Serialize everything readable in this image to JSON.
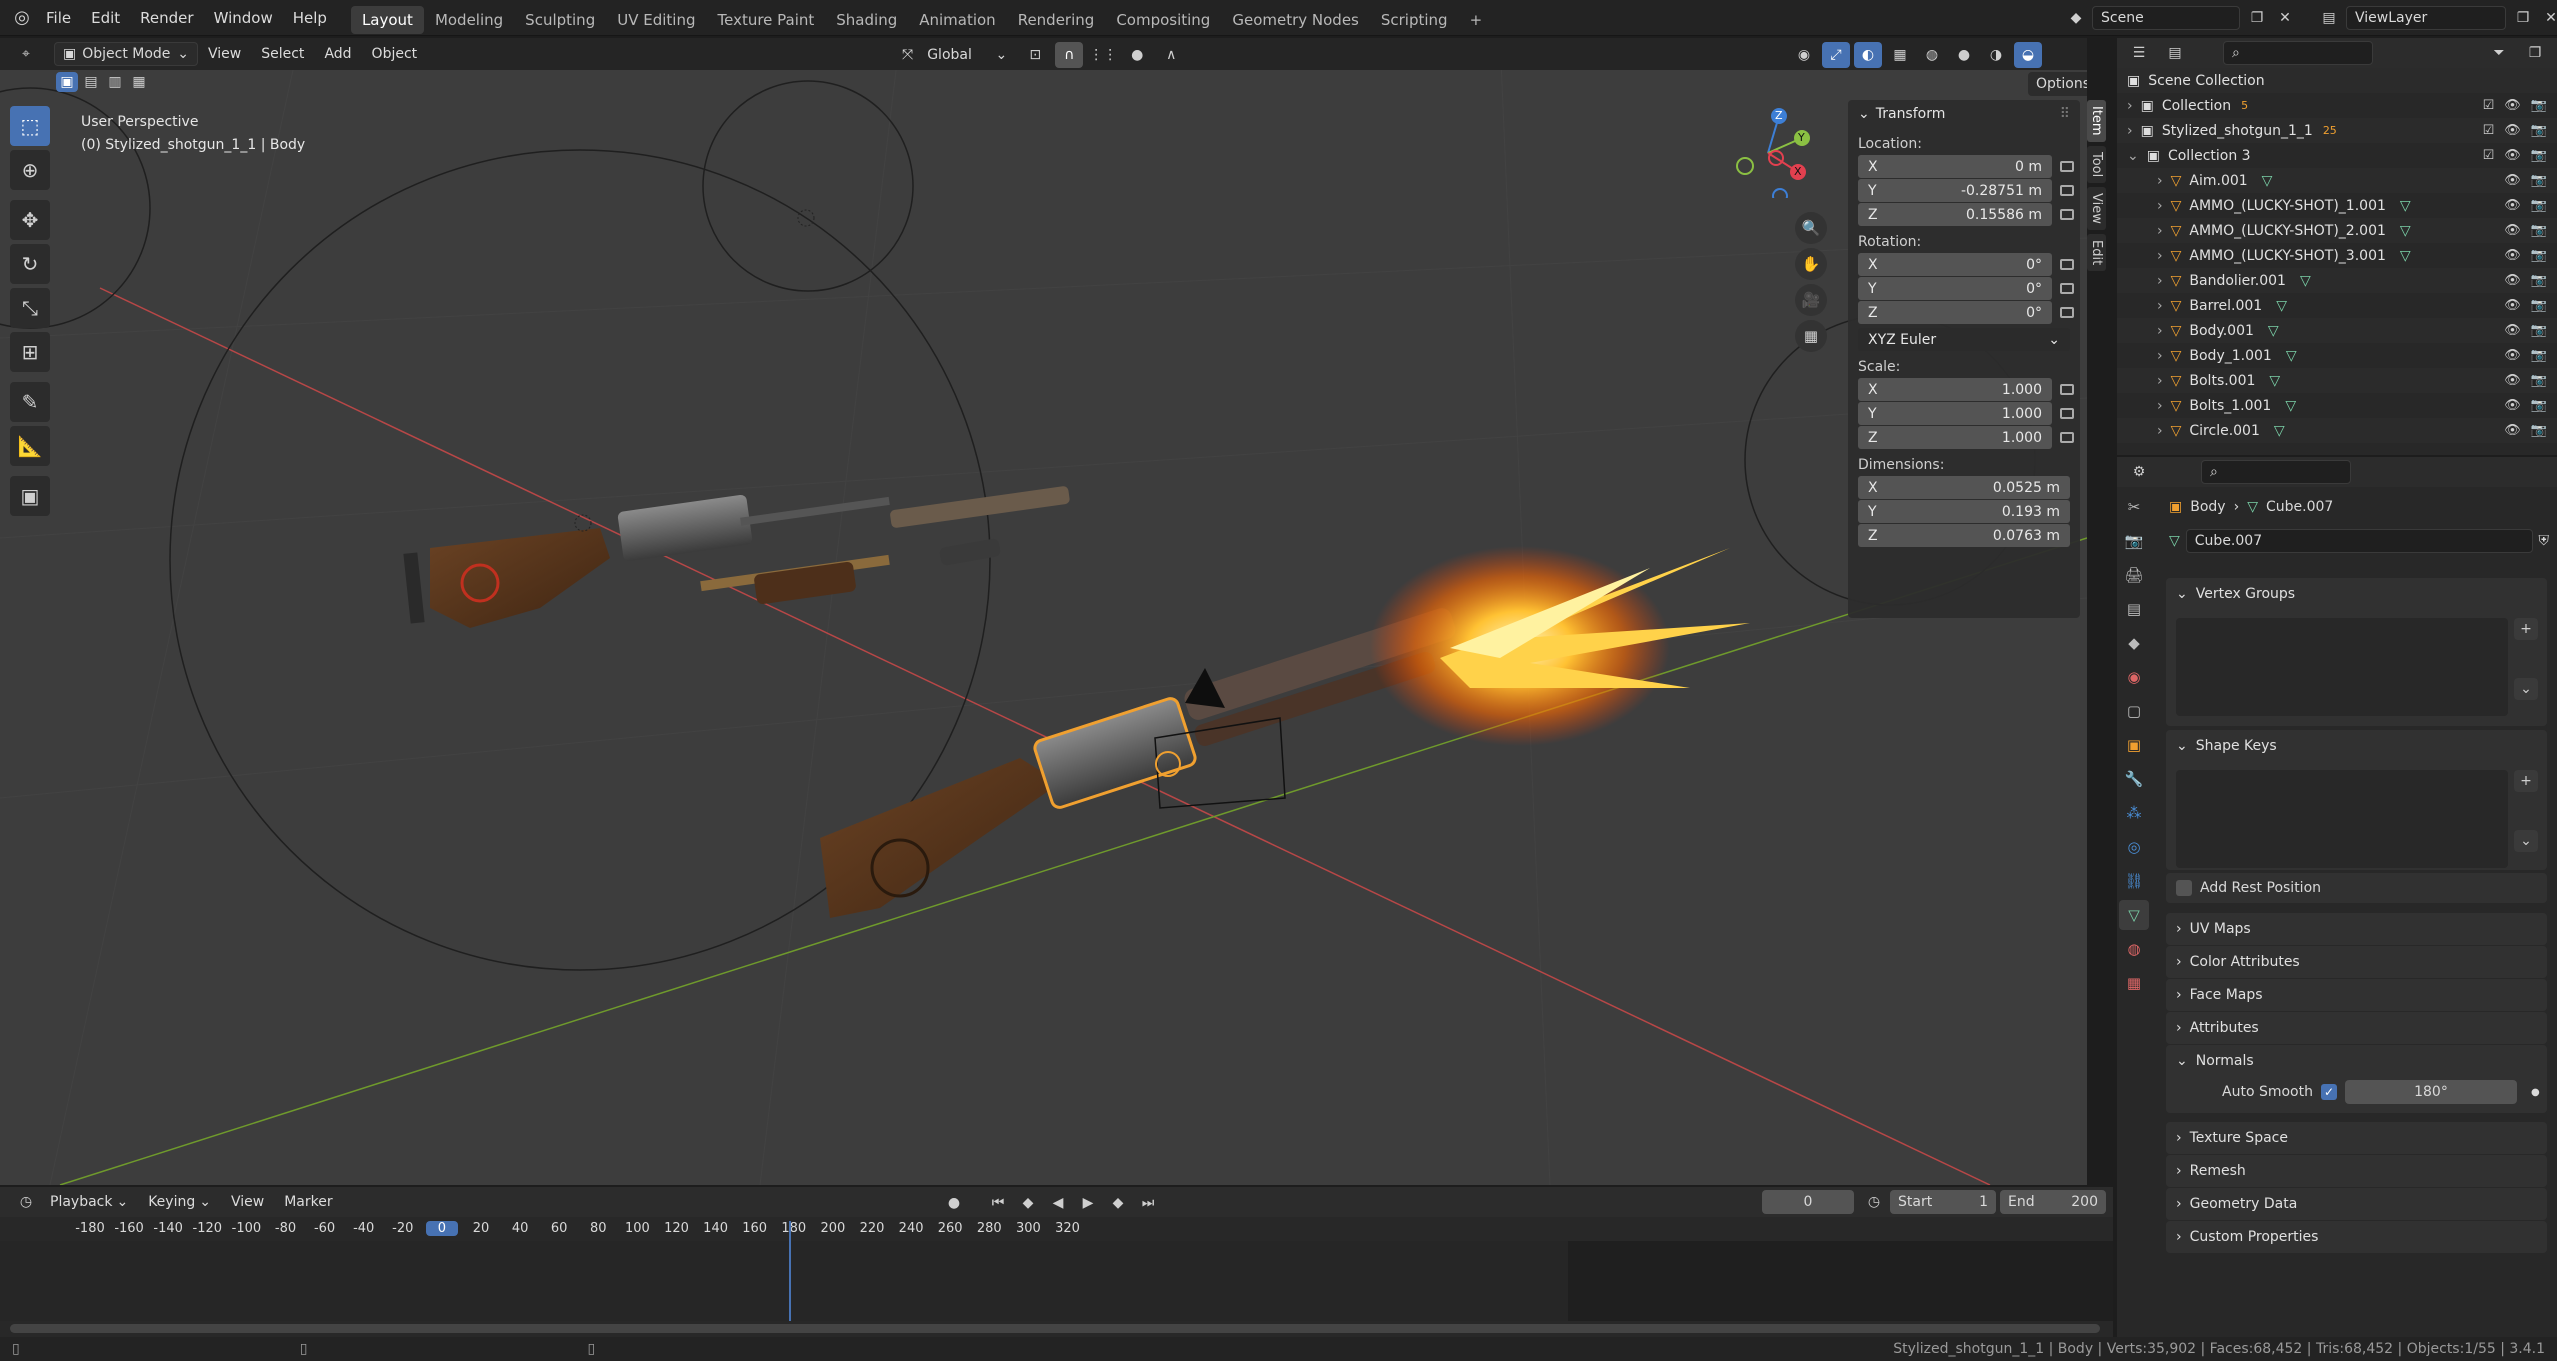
{
  "menu": {
    "items": [
      "File",
      "Edit",
      "Render",
      "Window",
      "Help"
    ]
  },
  "workspaces": [
    "Layout",
    "Modeling",
    "Sculpting",
    "UV Editing",
    "Texture Paint",
    "Shading",
    "Animation",
    "Rendering",
    "Compositing",
    "Geometry Nodes",
    "Scripting"
  ],
  "active_workspace": "Layout",
  "scene": {
    "name": "Scene",
    "view_layer": "ViewLayer"
  },
  "viewport_header": {
    "mode": "Object Mode",
    "menus": [
      "View",
      "Select",
      "Add",
      "Object"
    ],
    "orientation": "Global",
    "options_label": "Options"
  },
  "overlay_text": {
    "perspective": "User Perspective",
    "object": "(0) Stylized_shotgun_1_1 | Body"
  },
  "gizmo": {
    "x": "X",
    "y": "Y",
    "z": "Z",
    "colors": {
      "x": "#e2404f",
      "y": "#8bc043",
      "z": "#3d7fd6"
    }
  },
  "npanel": {
    "title": "Transform",
    "location_label": "Location:",
    "location": [
      {
        "axis": "X",
        "value": "0 m"
      },
      {
        "axis": "Y",
        "value": "-0.28751 m"
      },
      {
        "axis": "Z",
        "value": "0.15586 m"
      }
    ],
    "rotation_label": "Rotation:",
    "rotation": [
      {
        "axis": "X",
        "value": "0°"
      },
      {
        "axis": "Y",
        "value": "0°"
      },
      {
        "axis": "Z",
        "value": "0°"
      }
    ],
    "rotation_mode": "XYZ Euler",
    "scale_label": "Scale:",
    "scale": [
      {
        "axis": "X",
        "value": "1.000"
      },
      {
        "axis": "Y",
        "value": "1.000"
      },
      {
        "axis": "Z",
        "value": "1.000"
      }
    ],
    "dimensions_label": "Dimensions:",
    "dimensions": [
      {
        "axis": "X",
        "value": "0.0525 m"
      },
      {
        "axis": "Y",
        "value": "0.193 m"
      },
      {
        "axis": "Z",
        "value": "0.0763 m"
      }
    ],
    "tabs": [
      "Item",
      "Tool",
      "View",
      "Edit"
    ]
  },
  "outliner": {
    "root": "Scene Collection",
    "rows": [
      {
        "name": "Collection",
        "type": "collection",
        "indent": 1,
        "badge": "5"
      },
      {
        "name": "Stylized_shotgun_1_1",
        "type": "collection",
        "indent": 1,
        "badge": "25"
      },
      {
        "name": "Collection 3",
        "type": "collection",
        "indent": 1,
        "badge": ""
      },
      {
        "name": "Aim.001",
        "type": "mesh",
        "indent": 2,
        "badge": ""
      },
      {
        "name": "AMMO_(LUCKY-SHOT)_1.001",
        "type": "mesh",
        "indent": 2,
        "badge": ""
      },
      {
        "name": "AMMO_(LUCKY-SHOT)_2.001",
        "type": "mesh",
        "indent": 2,
        "badge": ""
      },
      {
        "name": "AMMO_(LUCKY-SHOT)_3.001",
        "type": "mesh",
        "indent": 2,
        "badge": ""
      },
      {
        "name": "Bandolier.001",
        "type": "mesh",
        "indent": 2,
        "badge": ""
      },
      {
        "name": "Barrel.001",
        "type": "mesh",
        "indent": 2,
        "badge": ""
      },
      {
        "name": "Body.001",
        "type": "mesh",
        "indent": 2,
        "badge": ""
      },
      {
        "name": "Body_1.001",
        "type": "mesh",
        "indent": 2,
        "badge": ""
      },
      {
        "name": "Bolts.001",
        "type": "mesh",
        "indent": 2,
        "badge": ""
      },
      {
        "name": "Bolts_1.001",
        "type": "mesh",
        "indent": 2,
        "badge": ""
      },
      {
        "name": "Circle.001",
        "type": "mesh",
        "indent": 2,
        "badge": ""
      }
    ]
  },
  "properties": {
    "breadcrumb": {
      "object": "Body",
      "mesh": "Cube.007"
    },
    "datablock": "Cube.007",
    "panels": {
      "vertex_groups": "Vertex Groups",
      "shape_keys": "Shape Keys",
      "add_rest_position": "Add Rest Position",
      "uv_maps": "UV Maps",
      "color_attributes": "Color Attributes",
      "face_maps": "Face Maps",
      "attributes": "Attributes",
      "normals": "Normals",
      "auto_smooth_label": "Auto Smooth",
      "auto_smooth_angle": "180°",
      "texture_space": "Texture Space",
      "remesh": "Remesh",
      "geometry_data": "Geometry Data",
      "custom_properties": "Custom Properties"
    }
  },
  "timeline": {
    "menus": [
      "Playback",
      "Keying",
      "View",
      "Marker"
    ],
    "current_frame": "0",
    "start_label": "Start",
    "start": "1",
    "end_label": "End",
    "end": "200",
    "ticks": [
      "-180",
      "-160",
      "-140",
      "-120",
      "-100",
      "-80",
      "-60",
      "-40",
      "-20",
      "0",
      "20",
      "40",
      "60",
      "80",
      "100",
      "120",
      "140",
      "160",
      "180",
      "200",
      "220",
      "240",
      "260",
      "280",
      "300",
      "320"
    ]
  },
  "status": {
    "text": "Stylized_shotgun_1_1 | Body | Verts:35,902 | Faces:68,452 | Tris:68,452 | Objects:1/55 | 3.4.1"
  }
}
